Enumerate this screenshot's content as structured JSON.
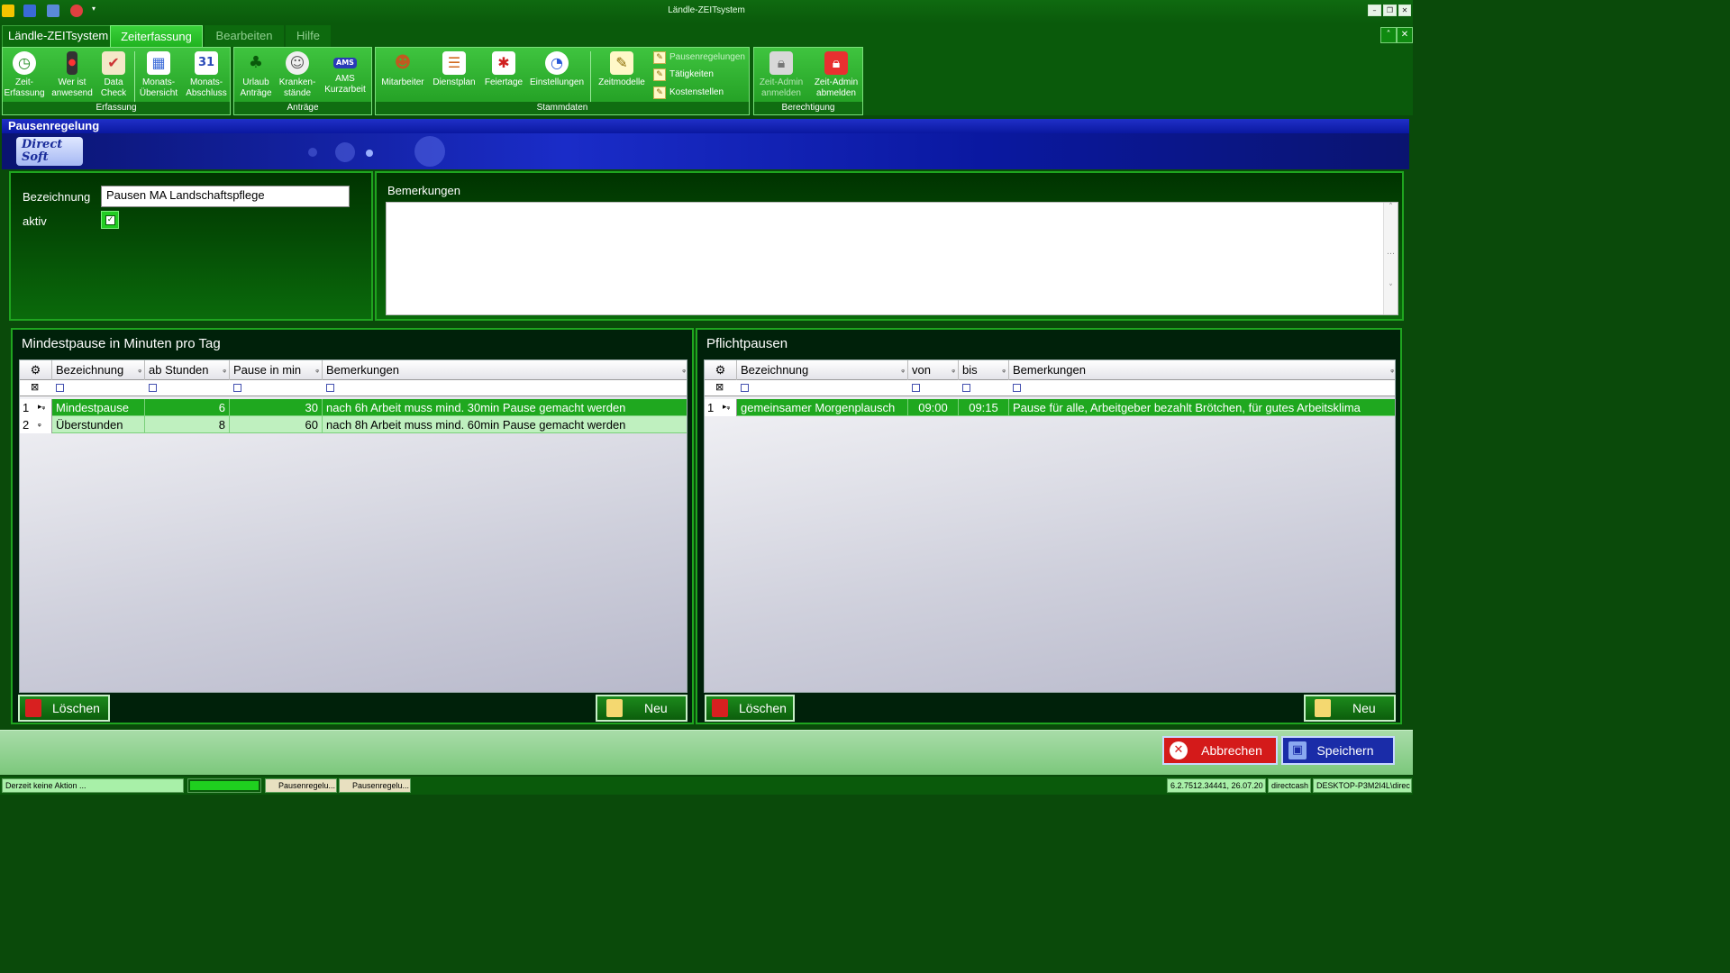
{
  "window": {
    "title": "Ländle-ZEITsystem"
  },
  "tabs": {
    "app": "Ländle-ZEITsystem",
    "items": [
      "Zeiterfassung",
      "Bearbeiten",
      "Hilfe"
    ]
  },
  "ribbon": {
    "groups": {
      "erfassung": "Erfassung",
      "antraege": "Anträge",
      "stammdaten": "Stammdaten",
      "berechtigung": "Berechtigung"
    },
    "erfassung": [
      {
        "l1": "Zeit-",
        "l2": "Erfassung",
        "icon": "clock-icon"
      },
      {
        "l1": "Wer ist",
        "l2": "anwesend",
        "icon": "traffic-light-icon"
      },
      {
        "l1": "Data",
        "l2": "Check",
        "icon": "clipboard-icon"
      },
      {
        "l1": "Monats-",
        "l2": "Übersicht",
        "icon": "calendar-grid-icon"
      },
      {
        "l1": "Monats-",
        "l2": "Abschluss",
        "icon": "calendar-31-icon"
      }
    ],
    "antraege": [
      {
        "l1": "Urlaub",
        "l2": "Anträge",
        "icon": "palm-tree-icon"
      },
      {
        "l1": "Kranken-",
        "l2": "stände",
        "icon": "doctor-icon"
      },
      {
        "l1": "AMS",
        "l2": "Kurzarbeit",
        "icon": "ams-icon"
      }
    ],
    "stammdaten": [
      {
        "l1": "Mitarbeiter",
        "icon": "people-icon"
      },
      {
        "l1": "Dienstplan",
        "icon": "schedule-icon"
      },
      {
        "l1": "Feiertage",
        "icon": "holiday-calendar-icon"
      },
      {
        "l1": "Einstellungen",
        "icon": "settings-clock-icon"
      },
      {
        "l1": "Zeitmodelle",
        "icon": "notepad-icon"
      }
    ],
    "stammdaten_small": [
      "Pausenregelungen",
      "Tätigkeiten",
      "Kostenstellen"
    ],
    "berechtigung": [
      {
        "l1": "Zeit-Admin",
        "l2": "anmelden",
        "icon": "lock-login-icon"
      },
      {
        "l1": "Zeit-Admin",
        "l2": "abmelden",
        "icon": "lock-logout-icon"
      }
    ]
  },
  "form": {
    "header": "Pausenregelung",
    "logo": "Direct Soft",
    "bezeichnung_label": "Bezeichnung",
    "bezeichnung_value": "Pausen MA Landschaftspflege",
    "aktiv_label": "aktiv",
    "aktiv_checked": true,
    "bemerkungen_label": "Bemerkungen"
  },
  "mindestpause": {
    "title": "Mindestpause in Minuten  pro Tag",
    "columns": [
      "Bezeichnung",
      "ab Stunden",
      "Pause in min",
      "Bemerkungen"
    ],
    "rows": [
      {
        "n": "1",
        "bez": "Mindestpause",
        "ab": "6",
        "pause": "30",
        "bem": "nach 6h Arbeit muss mind. 30min Pause gemacht werden"
      },
      {
        "n": "2",
        "bez": "Überstunden",
        "ab": "8",
        "pause": "60",
        "bem": "nach 8h Arbeit muss mind. 60min Pause gemacht werden"
      }
    ],
    "delete_label": "Löschen",
    "new_label": "Neu"
  },
  "pflichtpausen": {
    "title": "Pflichtpausen",
    "columns": [
      "Bezeichnung",
      "von",
      "bis",
      "Bemerkungen"
    ],
    "rows": [
      {
        "n": "1",
        "bez": "gemeinsamer Morgenplausch",
        "von": "09:00",
        "bis": "09:15",
        "bem": "Pause für alle, Arbeitgeber bezahlt Brötchen, für gutes Arbeitsklima"
      }
    ],
    "delete_label": "Löschen",
    "new_label": "Neu"
  },
  "actions": {
    "cancel": "Abbrechen",
    "save": "Speichern"
  },
  "statusbar": {
    "action": "Derzeit keine Aktion ...",
    "task1": "Pausenregelu...",
    "task2": "Pausenregelu...",
    "version": "6.2.7512.34441, 26.07.20",
    "user": "directcash",
    "machine": "DESKTOP-P3M2I4L\\direc"
  },
  "colors": {
    "ribbon": "#1f9a20",
    "selected_row": "#1fa81f",
    "alt_row": "#bff0bf",
    "header_blue": "#1a2cc8",
    "cancel": "#d41a1a",
    "save": "#1a2ca8"
  }
}
